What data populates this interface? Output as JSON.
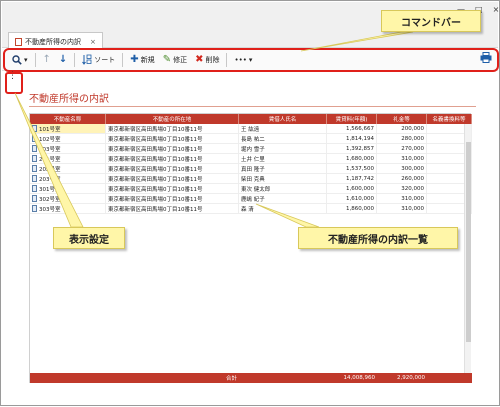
{
  "window": {
    "tab_label": "不動産所得の内訳",
    "tab_close": "×",
    "minimize": "—",
    "maximize": "□",
    "close": "×"
  },
  "toolbar": {
    "search_icon": "search-icon",
    "dropdown": "▾",
    "up_icon": "↑",
    "down_icon": "↓",
    "sort_label": "ソート",
    "new_label": "新規",
    "edit_label": "修正",
    "delete_label": "削除",
    "more_label": "•••",
    "more_dropdown": "▾"
  },
  "settings": {
    "glyph": "⋮"
  },
  "page": {
    "title": "不動産所得の内訳"
  },
  "grid": {
    "headers": [
      "不動産名称",
      "不動産の所在地",
      "賃借人氏名",
      "賃貸料(年額)",
      "礼金等",
      "名義書換料等"
    ],
    "rows": [
      {
        "name": "101号室",
        "address": "東京都新宿区高田馬場0丁目10番11号",
        "tenant": "王 紘遠",
        "rent": "1,566,667",
        "key_money": "200,000",
        "renewal_fee": ""
      },
      {
        "name": "102号室",
        "address": "東京都新宿区高田馬場0丁目10番11号",
        "tenant": "長島 祐二",
        "rent": "1,814,194",
        "key_money": "280,000",
        "renewal_fee": ""
      },
      {
        "name": "103号室",
        "address": "東京都新宿区高田馬場0丁目10番11号",
        "tenant": "堀内 雪子",
        "rent": "1,392,857",
        "key_money": "270,000",
        "renewal_fee": ""
      },
      {
        "name": "201号室",
        "address": "東京都新宿区高田馬場0丁目10番11号",
        "tenant": "土井 仁里",
        "rent": "1,680,000",
        "key_money": "310,000",
        "renewal_fee": ""
      },
      {
        "name": "202号室",
        "address": "東京都新宿区高田馬場0丁目10番11号",
        "tenant": "真田 隆子",
        "rent": "1,537,500",
        "key_money": "300,000",
        "renewal_fee": ""
      },
      {
        "name": "203号室",
        "address": "東京都新宿区高田馬場0丁目10番11号",
        "tenant": "柴田 克典",
        "rent": "1,187,742",
        "key_money": "260,000",
        "renewal_fee": ""
      },
      {
        "name": "301号室",
        "address": "東京都新宿区高田馬場0丁目10番11号",
        "tenant": "東次 健太郎",
        "rent": "1,600,000",
        "key_money": "320,000",
        "renewal_fee": ""
      },
      {
        "name": "302号室",
        "address": "東京都新宿区高田馬場0丁目10番11号",
        "tenant": "鹿嶋 紀子",
        "rent": "1,610,000",
        "key_money": "310,000",
        "renewal_fee": ""
      },
      {
        "name": "303号室",
        "address": "東京都新宿区高田馬場0丁目10番11号",
        "tenant": "森 清",
        "rent": "1,860,000",
        "key_money": "310,000",
        "renewal_fee": ""
      }
    ],
    "footer": {
      "label": "合計",
      "rent_total": "14,008,960",
      "key_money_total": "2,920,000"
    }
  },
  "callouts": {
    "command_bar": "コマンドバー",
    "display_settings": "表示設定",
    "list": "不動産所得の内訳一覧"
  },
  "colors": {
    "accent": "#c0392b",
    "highlight": "#e0201a",
    "callout": "#fff6a8"
  }
}
